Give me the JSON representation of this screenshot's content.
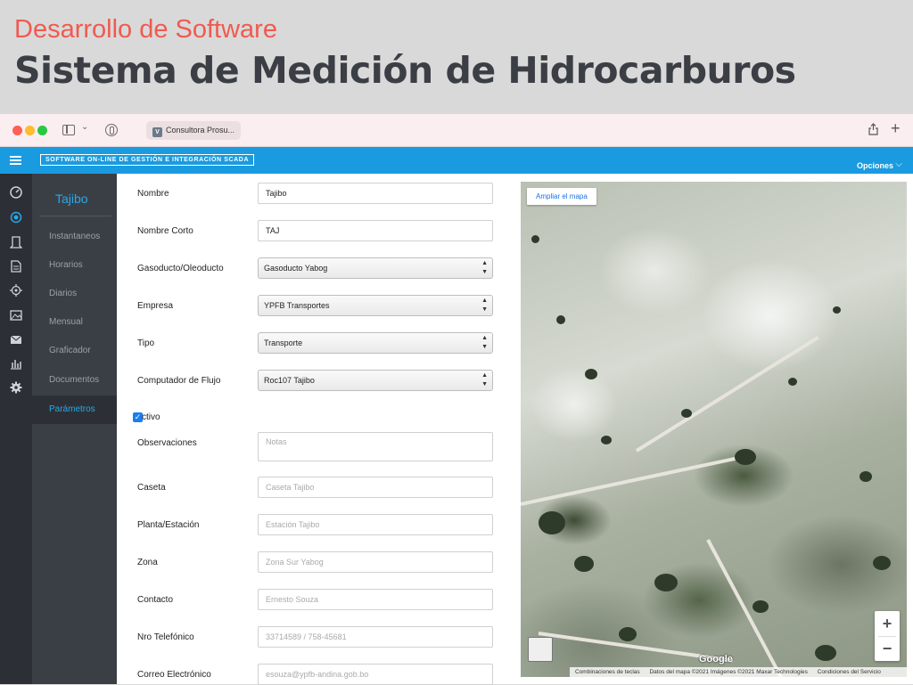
{
  "slide": {
    "subtitle": "Desarrollo de Software",
    "title": "Sistema de Medición de Hidrocarburos"
  },
  "browser": {
    "tab_title": "Consultora Prosu...",
    "tab_favicon": "V"
  },
  "appbar": {
    "brand": "SOFTWARE ON-LINE DE GESTIÓN E INTEGRACIÓN SCADA",
    "options": "Opciones"
  },
  "rail": {
    "icons": [
      "dashboard-icon",
      "target-icon",
      "device-icon",
      "document-icon",
      "crosshair-icon",
      "image-icon",
      "mail-icon",
      "bar-chart-icon",
      "gear-icon"
    ]
  },
  "subnav": {
    "title": "Tajibo",
    "items": [
      {
        "label": "Instantaneos"
      },
      {
        "label": "Horarios"
      },
      {
        "label": "Diarios"
      },
      {
        "label": "Mensual"
      },
      {
        "label": "Graficador"
      },
      {
        "label": "Documentos"
      },
      {
        "label": "Parámetros"
      }
    ]
  },
  "form": {
    "nombre": {
      "label": "Nombre",
      "value": "Tajibo"
    },
    "nombre_corto": {
      "label": "Nombre Corto",
      "value": "TAJ"
    },
    "gasoducto": {
      "label": "Gasoducto/Oleoducto",
      "value": "Gasoducto Yabog"
    },
    "empresa": {
      "label": "Empresa",
      "value": "YPFB Transportes"
    },
    "tipo": {
      "label": "Tipo",
      "value": "Transporte"
    },
    "computador": {
      "label": "Computador de Flujo",
      "value": "Roc107 Tajibo"
    },
    "activo": {
      "label": "ctivo",
      "checked": true
    },
    "observaciones": {
      "label": "Observaciones",
      "placeholder": "Notas"
    },
    "caseta": {
      "label": "Caseta",
      "placeholder": "Caseta Tajibo"
    },
    "planta": {
      "label": "Planta/Estación",
      "placeholder": "Estación Tajibo"
    },
    "zona": {
      "label": "Zona",
      "placeholder": "Zona Sur Yabog"
    },
    "contacto": {
      "label": "Contacto",
      "placeholder": "Ernesto Souza"
    },
    "telefono": {
      "label": "Nro Telefónico",
      "placeholder": "33714589 / 758-45681"
    },
    "correo": {
      "label": "Correo Electrónico",
      "placeholder": "esouza@ypfb-andina.gob.bo"
    }
  },
  "map": {
    "enlarge_button": "Ampliar el mapa",
    "zoom_in": "+",
    "zoom_out": "−",
    "logo": "Google",
    "attribution": [
      "Combinaciones de teclas",
      "Datos del mapa ©2021 Imágenes ©2021 Maxar Technologies",
      "Condiciones del Servicio"
    ]
  },
  "colors": {
    "accent": "#1a9be0",
    "subtitle": "#f05a50",
    "title": "#3b3f45",
    "rail": "#2c3036",
    "subnav": "#3a3f46",
    "active_link": "#29a8e8"
  }
}
